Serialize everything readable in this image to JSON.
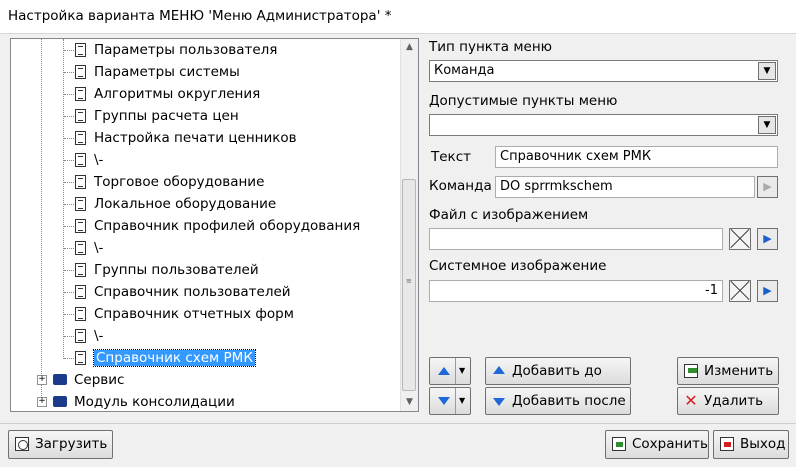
{
  "window": {
    "title": "Настройка варианта МЕНЮ 'Меню Администратора' *"
  },
  "tree": {
    "items": [
      {
        "label": "Параметры пользователя",
        "icon": "document-icon"
      },
      {
        "label": "Параметры системы",
        "icon": "document-icon"
      },
      {
        "label": "Алгоритмы округления",
        "icon": "document-icon"
      },
      {
        "label": "Группы расчета цен",
        "icon": "document-icon"
      },
      {
        "label": "Настройка печати ценников",
        "icon": "document-icon"
      },
      {
        "label": "\\-",
        "icon": "document-icon"
      },
      {
        "label": "Торговое оборудование",
        "icon": "document-icon"
      },
      {
        "label": "Локальное  оборудование",
        "icon": "document-icon"
      },
      {
        "label": "Справочник профилей оборудования",
        "icon": "document-icon"
      },
      {
        "label": "\\-",
        "icon": "document-icon"
      },
      {
        "label": "Группы пользователей",
        "icon": "document-icon"
      },
      {
        "label": "Справочник пользователей",
        "icon": "document-icon"
      },
      {
        "label": "Справочник отчетных форм",
        "icon": "document-icon"
      },
      {
        "label": "\\-",
        "icon": "document-icon"
      },
      {
        "label": "Справочник схем РМК",
        "icon": "document-icon",
        "selected": true
      }
    ],
    "groups": [
      {
        "label": "Сервис",
        "icon": "book-icon"
      },
      {
        "label": "Модуль консолидации",
        "icon": "book-icon"
      }
    ]
  },
  "form": {
    "menu_type_label": "Тип пункта меню",
    "menu_type_value": "Команда",
    "allowed_items_label": "Допустимые пункты меню",
    "allowed_items_value": "",
    "text_label": "Текст",
    "text_value": "Справочник схем РМК",
    "command_label": "Команда",
    "command_value": "DO sprrmkschem",
    "image_file_label": "Файл с изображением",
    "image_file_value": "",
    "system_image_label": "Системное изображение",
    "system_image_value": "-1"
  },
  "buttons": {
    "add_before": "Добавить до",
    "add_after": "Добавить после",
    "edit": "Изменить",
    "delete": "Удалить",
    "load": "Загрузить",
    "save": "Сохранить",
    "exit": "Выход"
  },
  "colors": {
    "selection": "#3399ff",
    "accent_blue": "#1f68d8",
    "delete_red": "#d42020"
  }
}
